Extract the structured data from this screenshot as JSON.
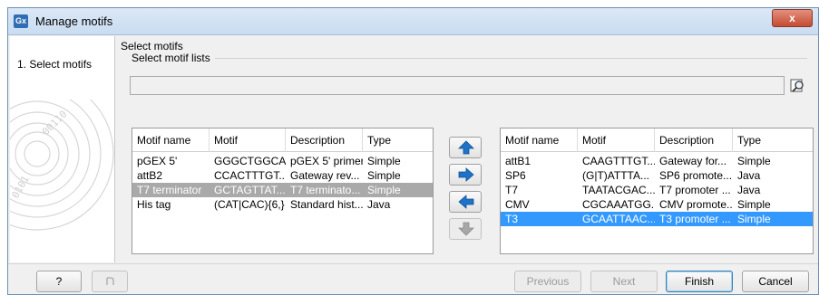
{
  "window": {
    "title": "Manage motifs",
    "app_icon": "Gx",
    "close_label": "x"
  },
  "steps": [
    {
      "label": "1.  Select motifs"
    }
  ],
  "content": {
    "heading": "Select motifs",
    "group_label": "Select motif lists",
    "path_value": ""
  },
  "left_table": {
    "columns": [
      "Motif name",
      "Motif",
      "Description",
      "Type"
    ],
    "rows": [
      [
        "pGEX 5'",
        "GGGCTGGCA...",
        "pGEX 5' primer",
        "Simple"
      ],
      [
        "attB2",
        "CCACTTTGT...",
        "Gateway rev...",
        "Simple"
      ],
      [
        "T7 terminator",
        "GCTAGTTAT...",
        "T7 terminato...",
        "Simple"
      ],
      [
        "His tag",
        "(CAT|CAC){6,}",
        "Standard hist...",
        "Java"
      ]
    ],
    "selected_row": 2
  },
  "right_table": {
    "columns": [
      "Motif name",
      "Motif",
      "Description",
      "Type"
    ],
    "rows": [
      [
        "attB1",
        "CAAGTTTGT...",
        "Gateway for...",
        "Simple"
      ],
      [
        "SP6",
        "(G|T)ATTTA...",
        "SP6 promote...",
        "Java"
      ],
      [
        "T7",
        "TAATACGAC...",
        "T7 promoter ...",
        "Java"
      ],
      [
        "CMV",
        "CGCAAATGG...",
        "CMV promote...",
        "Simple"
      ],
      [
        "T3",
        "GCAATTAAC...",
        "T3 promoter ...",
        "Simple"
      ]
    ],
    "selected_row": 4
  },
  "move_buttons": [
    "move-up-icon",
    "move-right-icon",
    "move-left-icon",
    "move-down-icon"
  ],
  "footer": {
    "help_label": "?",
    "previous_label": "Previous",
    "next_label": "Next",
    "finish_label": "Finish",
    "cancel_label": "Cancel"
  },
  "colors": {
    "selection_blue": "#3399ff",
    "selection_gray": "#a9a9a9",
    "arrow_blue": "#1e73c8"
  }
}
